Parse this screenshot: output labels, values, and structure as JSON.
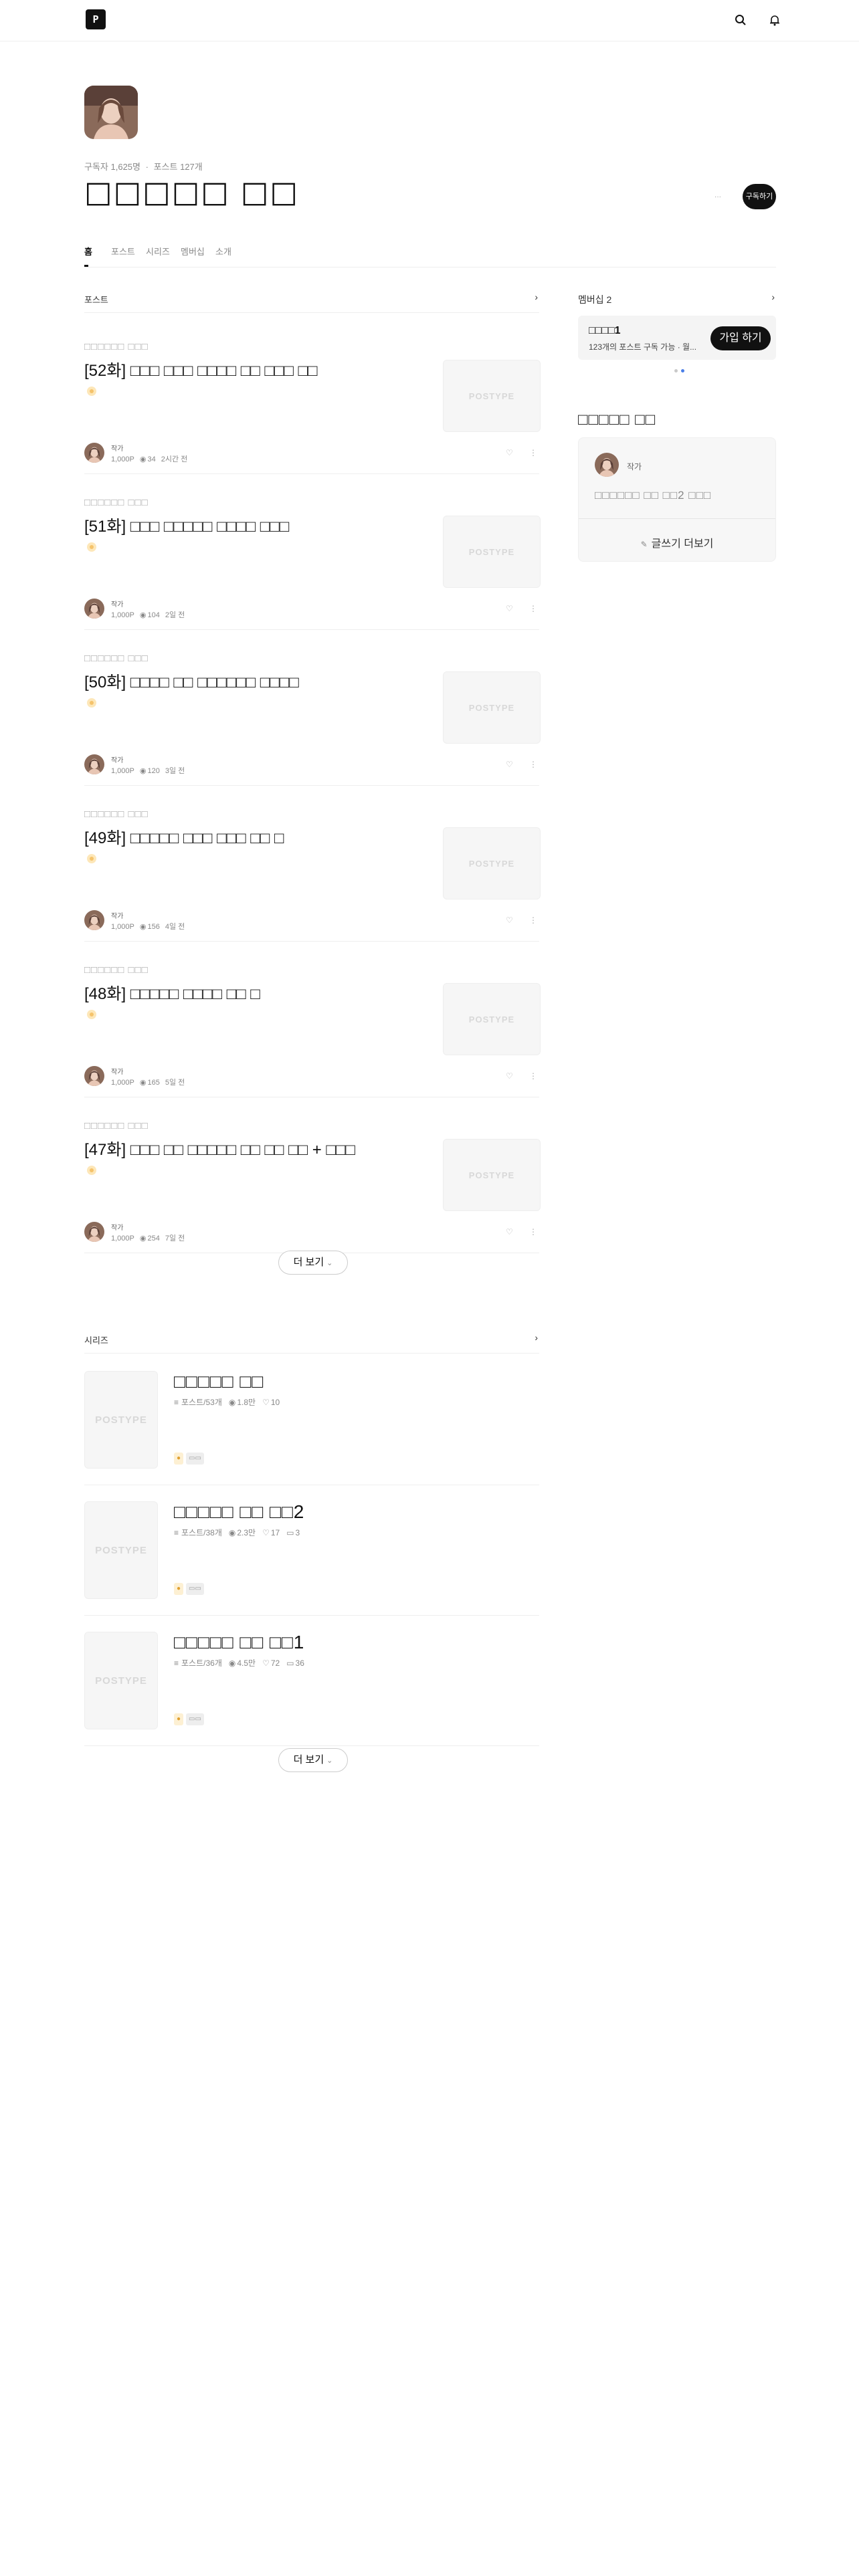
{
  "header": {
    "logo_text": "P",
    "search_icon": "search-icon",
    "bell_icon": "bell-icon"
  },
  "profile": {
    "stats": [
      "구독자 1,625명",
      "·",
      "포스트 127개"
    ],
    "title": "□□□□□ □□",
    "more_label": "···",
    "subscribe_label": "구독하기"
  },
  "tabs": [
    {
      "label": "홈",
      "active": true
    },
    {
      "label": "포스트",
      "active": false
    },
    {
      "label": "시리즈",
      "active": false
    },
    {
      "label": "멤버십",
      "active": false
    },
    {
      "label": "소개",
      "active": false
    }
  ],
  "posts_section": {
    "label": "포스트",
    "arrow_icon": "chevron-right-icon",
    "items": [
      {
        "series": "□□□□□□ □□□",
        "title": "[52화] □□□ □□□ □□□□ □□ □□□ □□",
        "thumb_text": "POSTYPE",
        "author": "작가",
        "price": "1,000P",
        "views": "34",
        "time": "2시간 전"
      },
      {
        "series": "□□□□□□ □□□",
        "title": "[51화] □□□ □□□□□ □□□□ □□□",
        "thumb_text": "POSTYPE",
        "author": "작가",
        "price": "1,000P",
        "views": "104",
        "time": "2일 전"
      },
      {
        "series": "□□□□□□ □□□",
        "title": "[50화] □□□□ □□ □□□□□□ □□□□",
        "thumb_text": "POSTYPE",
        "author": "작가",
        "price": "1,000P",
        "views": "120",
        "time": "3일 전"
      },
      {
        "series": "□□□□□□ □□□",
        "title": "[49화] □□□□□ □□□ □□□ □□ □",
        "thumb_text": "POSTYPE",
        "author": "작가",
        "price": "1,000P",
        "views": "156",
        "time": "4일 전"
      },
      {
        "series": "□□□□□□ □□□",
        "title": "[48화] □□□□□ □□□□ □□ □",
        "thumb_text": "POSTYPE",
        "author": "작가",
        "price": "1,000P",
        "views": "165",
        "time": "5일 전"
      },
      {
        "series": "□□□□□□ □□□",
        "title": "[47화] □□□ □□ □□□□□ □□ □□ □□ + □□□",
        "thumb_text": "POSTYPE",
        "author": "작가",
        "price": "1,000P",
        "views": "254",
        "time": "7일 전"
      }
    ],
    "more_label": "더 보기"
  },
  "series_section": {
    "label": "시리즈",
    "arrow_icon": "chevron-right-icon",
    "items": [
      {
        "title": "□□□□□ □□",
        "thumb_text": "POSTYPE",
        "count": "포스트/53개",
        "views": "1.8만",
        "likes": "10",
        "comments": ""
      },
      {
        "title": "□□□□□ □□ □□2",
        "thumb_text": "POSTYPE",
        "count": "포스트/38개",
        "views": "2.3만",
        "likes": "17",
        "comments": "3"
      },
      {
        "title": "□□□□□ □□ □□1",
        "thumb_text": "POSTYPE",
        "count": "포스트/36개",
        "views": "4.5만",
        "likes": "72",
        "comments": "36"
      }
    ],
    "more_label": "더 보기"
  },
  "sidebar": {
    "membership_label": "멤버십",
    "membership_count": "2",
    "membership": {
      "name": "□□□□1",
      "desc": "123개의 포스트 구독 가능 · 월...",
      "button": "가입 하기"
    },
    "community_title": "□□□□□ □□",
    "community": {
      "author": "작가",
      "text": "□□□□□□ □□ □□2 □□□",
      "button": "글쓰기 더보기"
    }
  },
  "colors": {
    "accent": "#111111",
    "dot_active": "#4a7ee8",
    "dot_inactive": "#c9c9c9",
    "bulb": "#f5c36b"
  }
}
